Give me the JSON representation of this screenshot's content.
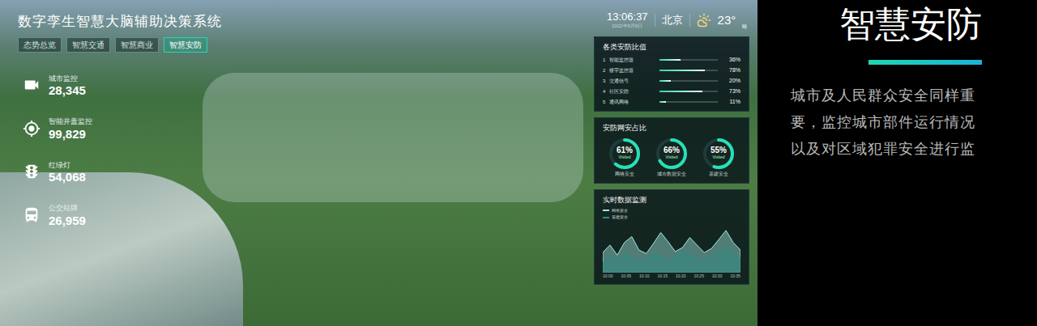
{
  "header": {
    "title": "数字孪生智慧大脑辅助决策系统",
    "tabs": [
      {
        "label": "态势总览",
        "selected": false
      },
      {
        "label": "智慧交通",
        "selected": false
      },
      {
        "label": "智慧商业",
        "selected": false
      },
      {
        "label": "智慧安防",
        "selected": true
      }
    ],
    "time": "13:06:37",
    "date": "2022年9月6日",
    "city": "北京",
    "temperature": "23°",
    "weather": "晴"
  },
  "stats": [
    {
      "label": "城市监控",
      "value": "28,345",
      "kind": "camera"
    },
    {
      "label": "智能井盖监控",
      "value": "99,829",
      "kind": "target"
    },
    {
      "label": "红绿灯",
      "value": "54,068",
      "kind": "traffic"
    },
    {
      "label": "公交站牌",
      "value": "26,959",
      "kind": "bus"
    }
  ],
  "ratio_panel": {
    "title": "各类安防比值",
    "items": [
      {
        "index": "1",
        "label": "智能监控器",
        "reading": "36%",
        "level": 0.36
      },
      {
        "index": "2",
        "label": "楼宇监控器",
        "reading": "78%",
        "level": 0.78
      },
      {
        "index": "3",
        "label": "交通信号",
        "reading": "20%",
        "level": 0.2
      },
      {
        "index": "4",
        "label": "社区安防",
        "reading": "73%",
        "level": 0.73
      },
      {
        "index": "5",
        "label": "通讯网络",
        "reading": "11%",
        "level": 0.11
      }
    ]
  },
  "share_panel": {
    "title": "安防网安占比",
    "rings": [
      {
        "reading": "61%",
        "sub": "Visited",
        "label": "网络安全",
        "level": 0.61
      },
      {
        "reading": "66%",
        "sub": "Visited",
        "label": "城市数据安全",
        "level": 0.66
      },
      {
        "reading": "55%",
        "sub": "Visited",
        "label": "基建安全",
        "level": 0.55
      }
    ]
  },
  "monitor_panel": {
    "title": "实时数据监测",
    "series": [
      {
        "name": "网络安全",
        "color": "#9fe8e0",
        "values": [
          40,
          55,
          35,
          60,
          72,
          45,
          38,
          58,
          80,
          62,
          42,
          50,
          70,
          55,
          40,
          48,
          66,
          84,
          60,
          45
        ]
      },
      {
        "name": "基建安全",
        "color": "#2a8f86",
        "values": [
          20,
          30,
          25,
          38,
          30,
          22,
          28,
          40,
          35,
          25,
          30,
          45,
          35,
          28,
          24,
          33,
          40,
          50,
          38,
          30
        ]
      }
    ],
    "x_ticks": [
      "10:00",
      "10:05",
      "10:10",
      "10:15",
      "10:20",
      "10:25",
      "10:30",
      "10:35"
    ]
  },
  "slide": {
    "title": "智慧安防",
    "body": "城市及人民群众安全同样重要，监控城市部件运行情况以及对区域犯罪安全进行监"
  }
}
